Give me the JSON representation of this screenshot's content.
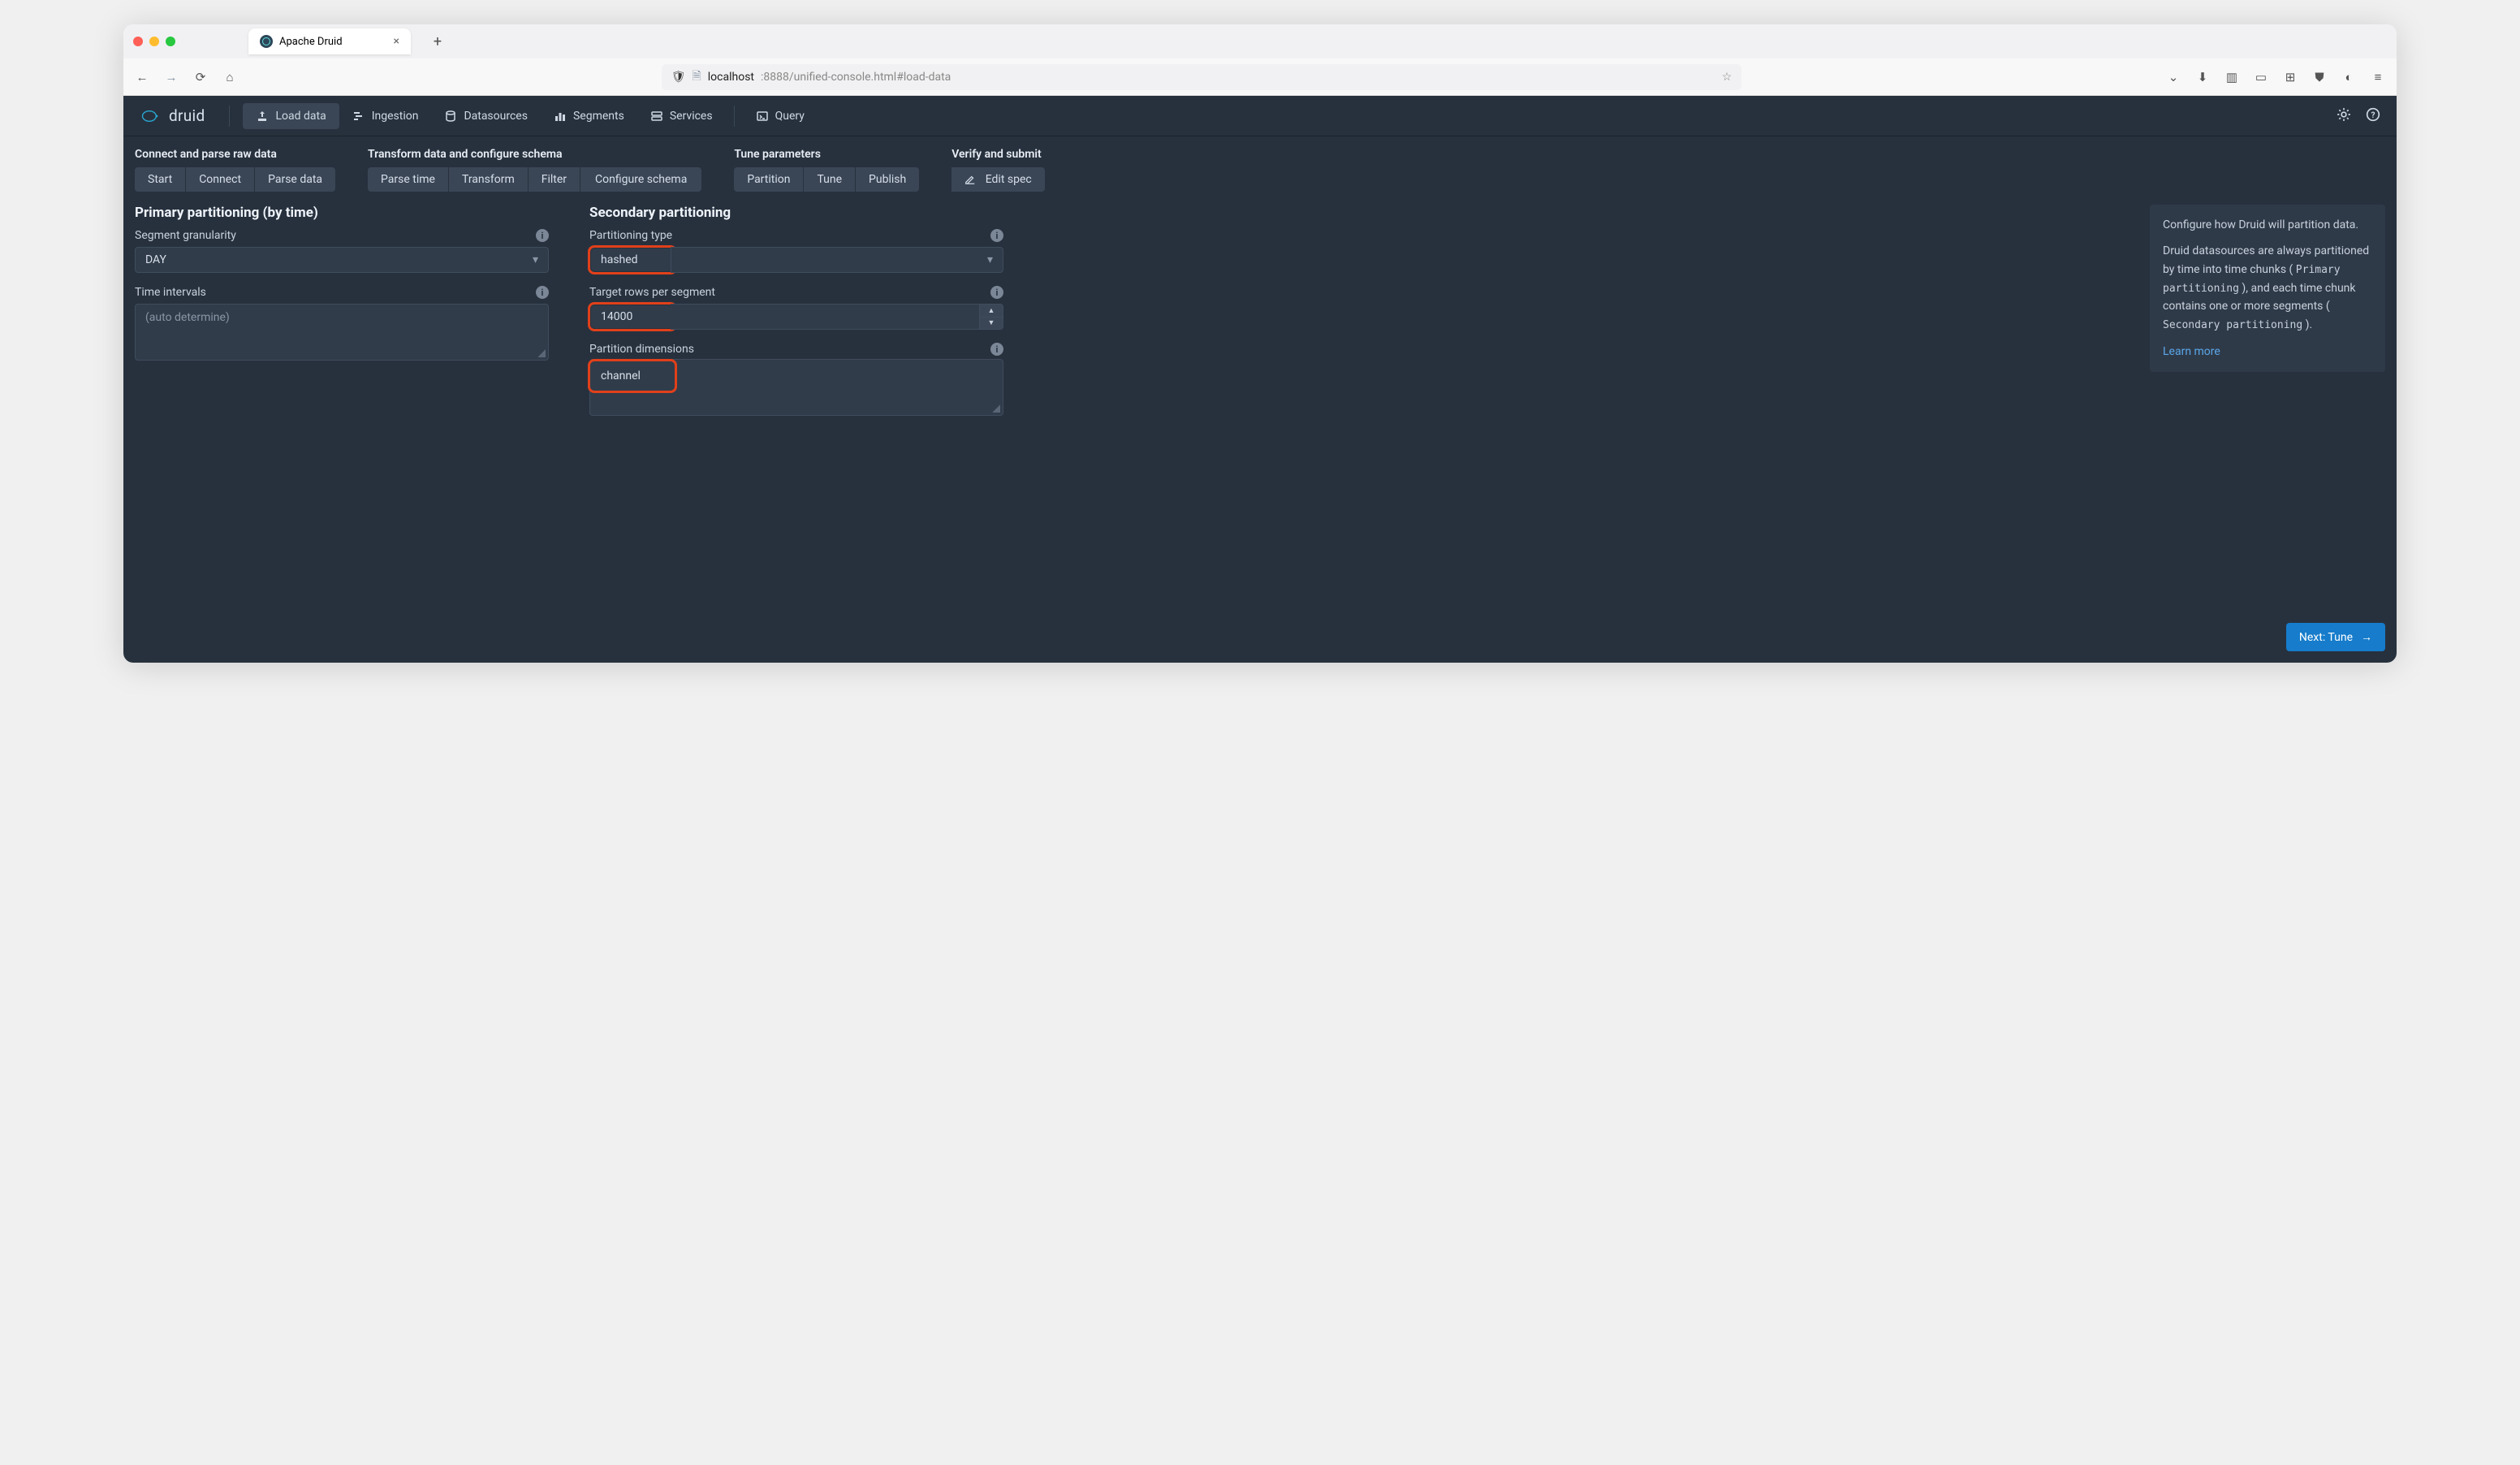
{
  "browser": {
    "tab_title": "Apache Druid",
    "url_host": "localhost",
    "url_path": ":8888/unified-console.html#load-data"
  },
  "header": {
    "logo_text": "druid",
    "nav": {
      "load_data": "Load data",
      "ingestion": "Ingestion",
      "datasources": "Datasources",
      "segments": "Segments",
      "services": "Services",
      "query": "Query"
    }
  },
  "stepgroups": {
    "connect": {
      "title": "Connect and parse raw data",
      "steps": [
        "Start",
        "Connect",
        "Parse data"
      ]
    },
    "transform": {
      "title": "Transform data and configure schema",
      "steps": [
        "Parse time",
        "Transform",
        "Filter",
        "Configure schema"
      ]
    },
    "tune": {
      "title": "Tune parameters",
      "steps": [
        "Partition",
        "Tune",
        "Publish"
      ]
    },
    "verify": {
      "title": "Verify and submit",
      "steps": [
        "Edit spec"
      ]
    }
  },
  "primary": {
    "title": "Primary partitioning (by time)",
    "segment_label": "Segment granularity",
    "segment_value": "DAY",
    "intervals_label": "Time intervals",
    "intervals_placeholder": "(auto determine)"
  },
  "secondary": {
    "title": "Secondary partitioning",
    "type_label": "Partitioning type",
    "type_value": "hashed",
    "target_label": "Target rows per segment",
    "target_value": "14000",
    "dims_label": "Partition dimensions",
    "dims_value": "channel"
  },
  "side": {
    "p1": "Configure how Druid will partition data.",
    "p2a": "Druid datasources are always partitioned by time into time chunks ( ",
    "p2code": "Primary partitioning",
    "p2b": " ), and each time chunk contains one or more segments ( ",
    "p2code2": "Secondary partitioning",
    "p2c": " ).",
    "learn": "Learn more"
  },
  "next_label": "Next: Tune"
}
